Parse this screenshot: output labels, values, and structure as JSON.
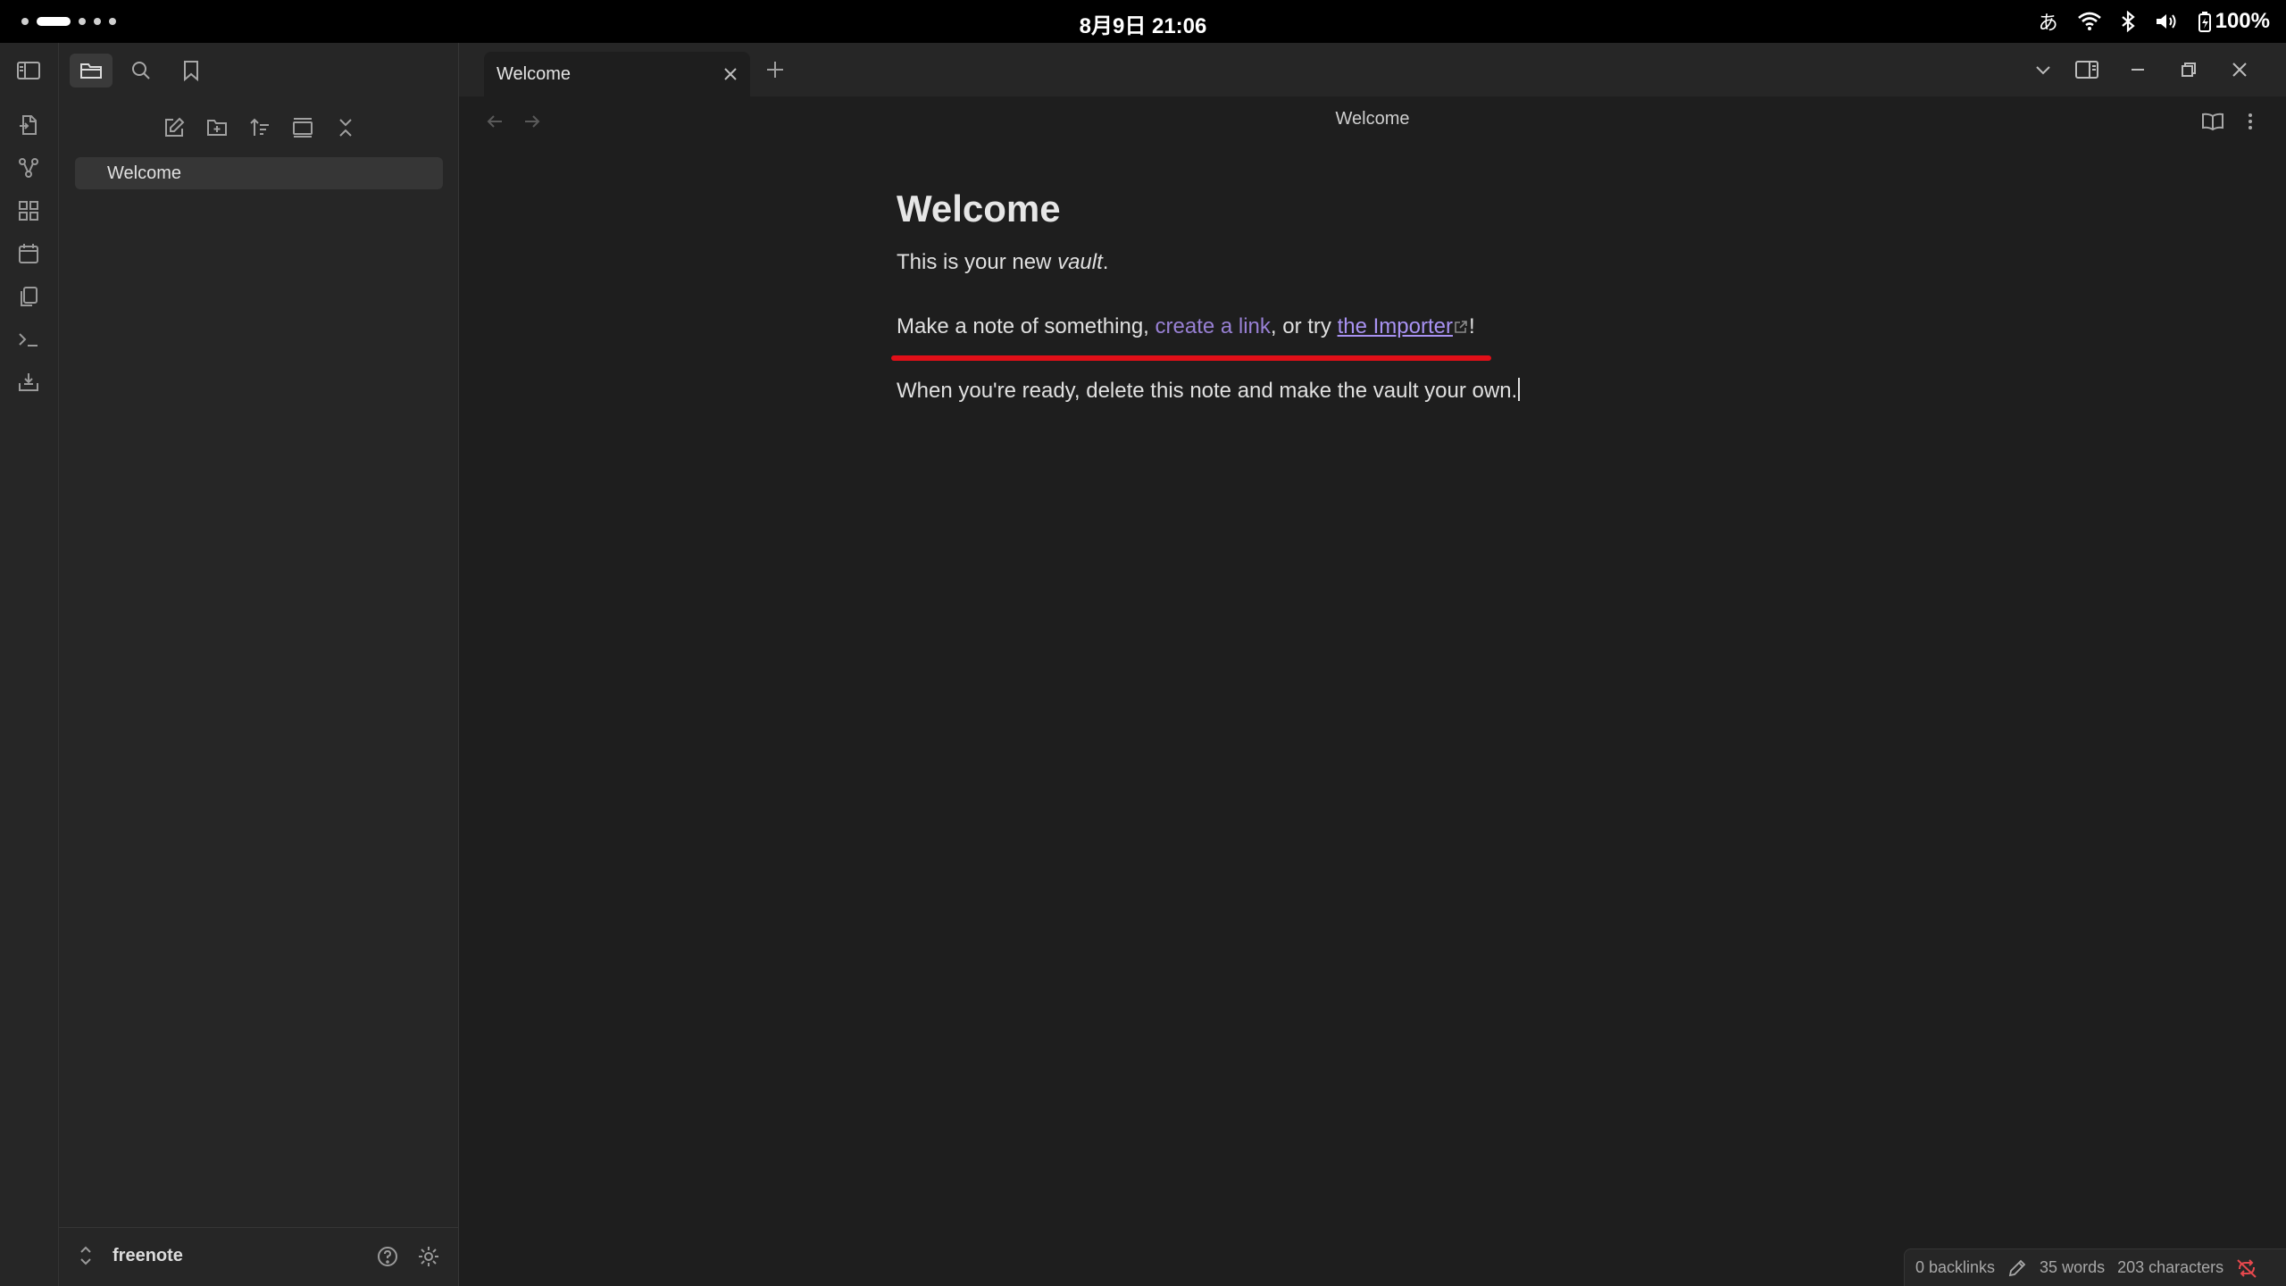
{
  "os_bar": {
    "clock": "8月9日 21:06",
    "ime": "あ",
    "battery": "100%"
  },
  "tabs": [
    {
      "label": "Welcome",
      "active": true
    }
  ],
  "sidebar": {
    "files": [
      {
        "name": "Welcome",
        "selected": true
      }
    ],
    "vault_name": "freenote"
  },
  "view_header": {
    "title": "Welcome"
  },
  "note": {
    "heading": "Welcome",
    "p1_before": "This is your new ",
    "p1_em": "vault",
    "p1_after": ".",
    "p2_before": "Make a note of something, ",
    "p2_internal_link": "create a link",
    "p2_middle": ", or try ",
    "p2_external_link": "the Importer",
    "p2_after": "!",
    "p3": "When you're ready, delete this note and make the vault your own."
  },
  "status_bar": {
    "backlinks": "0 backlinks",
    "words": "35 words",
    "characters": "203 characters"
  },
  "colors": {
    "annotation": "#e10f18",
    "internal_link": "#9880d4",
    "external_link": "#a892f2",
    "sync_error": "#e5484d"
  }
}
